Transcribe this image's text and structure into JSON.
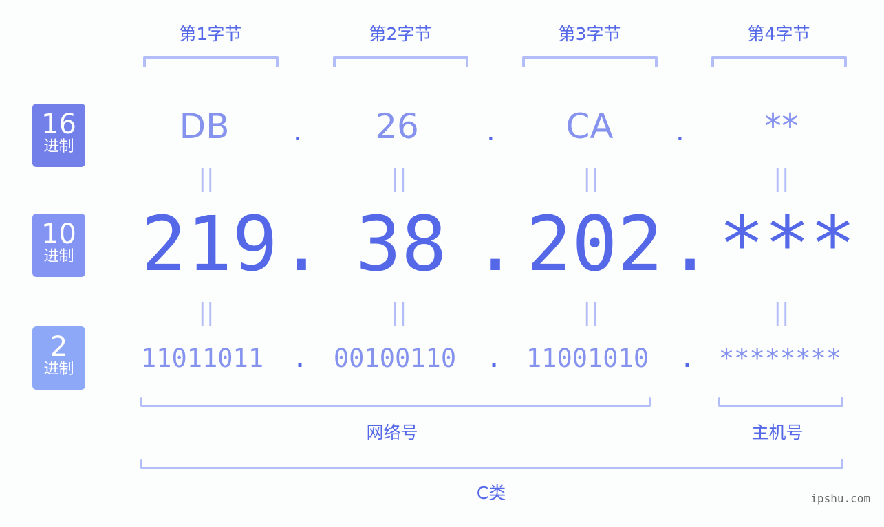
{
  "bytes": [
    {
      "title": "第1字节",
      "hex": "DB",
      "dec": "219",
      "bin": "11011011"
    },
    {
      "title": "第2字节",
      "hex": "26",
      "dec": "38",
      "bin": "00100110"
    },
    {
      "title": "第3字节",
      "hex": "CA",
      "dec": "202",
      "bin": "11001010"
    },
    {
      "title": "第4字节",
      "hex": "**",
      "dec": "***",
      "bin": "********"
    }
  ],
  "separator": ".",
  "equals": "||",
  "badges": [
    {
      "num": "16",
      "label": "进制",
      "color": "#7380ea"
    },
    {
      "num": "10",
      "label": "进制",
      "color": "#8394f3"
    },
    {
      "num": "2",
      "label": "进制",
      "color": "#8ea8f8"
    }
  ],
  "sections": {
    "network": "网络号",
    "host": "主机号",
    "class": "C类"
  },
  "watermark": "ipshu.com",
  "colors": {
    "accent": "#5569e8",
    "secondary": "#8593ee",
    "bracket": "#b3bdf7"
  }
}
